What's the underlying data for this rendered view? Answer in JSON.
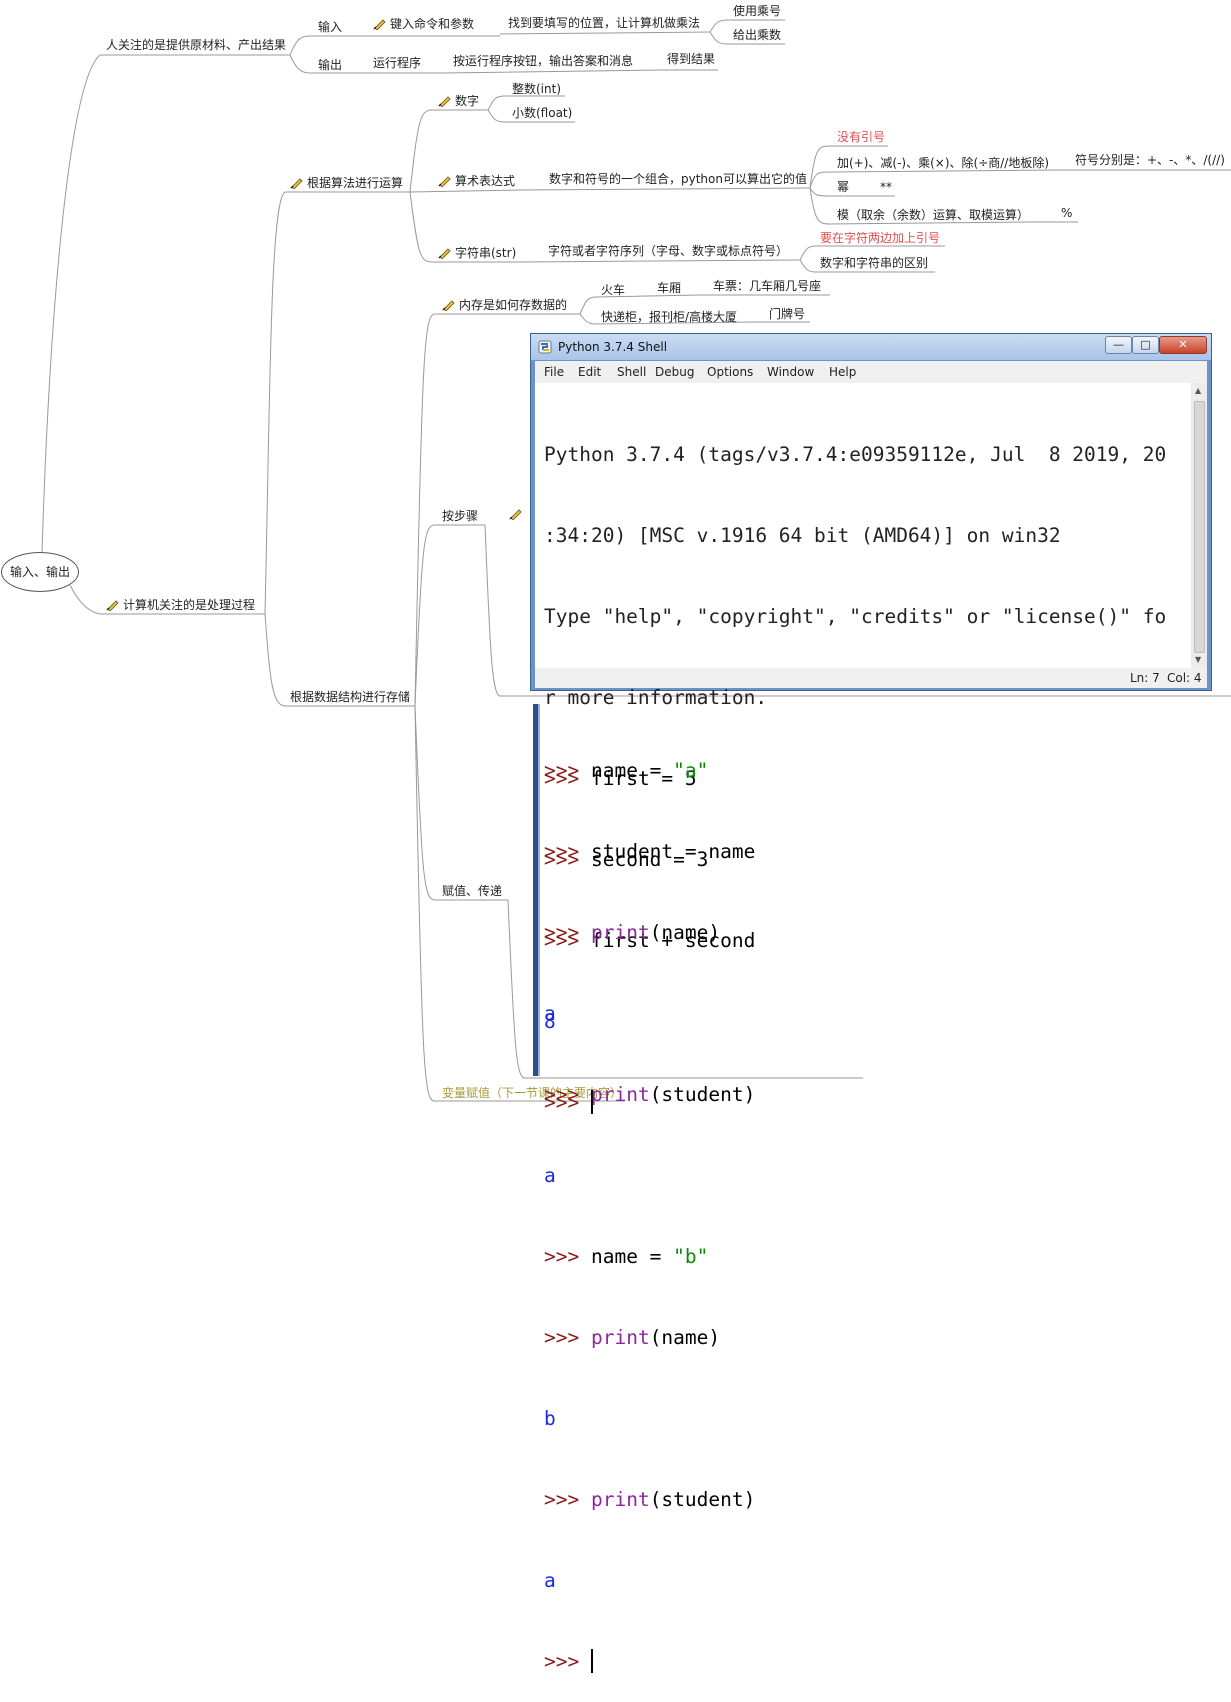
{
  "root": {
    "label": "输入、输出"
  },
  "human": {
    "label": "人关注的是提供原材料、产出结果",
    "input": {
      "label": "输入",
      "action": "键入命令和参数",
      "detail": "找到要填写的位置，让计算机做乘法",
      "children": [
        "使用乘号",
        "给出乘数"
      ]
    },
    "output": {
      "label": "输出",
      "action": "运行程序",
      "detail": "按运行程序按钮，输出答案和消息",
      "result": "得到结果"
    }
  },
  "computer": {
    "label": "计算机关注的是处理过程",
    "algo": {
      "label": "根据算法进行运算",
      "number": {
        "label": "数字",
        "children": [
          "整数(int)",
          "小数(float)"
        ]
      },
      "expr": {
        "label": "算术表达式",
        "detail": "数字和符号的一个组合，python可以算出它的值",
        "no_quote": "没有引号",
        "ops": "加(+)、减(-)、乘(×)、除(÷商//地板除)",
        "ops_symbols": "符号分别是：+、-、*、/(//)",
        "power": "幂",
        "power_sym": "**",
        "mod": "模（取余（余数）运算、取模运算）",
        "mod_sym": "%"
      },
      "str": {
        "label": "字符串(str)",
        "detail": "字符或者字符序列（字母、数字或标点符号）",
        "quote": "要在字符两边加上引号",
        "diff": "数字和字符串的区别"
      }
    },
    "data": {
      "label": "根据数据结构进行存储",
      "memory": {
        "label": "内存是如何存数据的",
        "train": "火车",
        "car": "车厢",
        "ticket": "车票：几车厢几号座",
        "locker": "快递柜，报刊柜/高楼大厦",
        "door": "门牌号"
      },
      "steps": {
        "label": "按步骤"
      },
      "assign": {
        "label": "赋值、传递"
      },
      "var": {
        "label": "变量赋值（下一节课的主要内容）"
      }
    }
  },
  "shell": {
    "title": "Python 3.7.4 Shell",
    "menu": [
      "File",
      "Edit",
      "Shell",
      "Debug",
      "Options",
      "Window",
      "Help"
    ],
    "buttons": [
      "—",
      "□",
      "✕"
    ],
    "banner": [
      "Python 3.7.4 (tags/v3.7.4:e09359112e, Jul  8 2019, 20",
      ":34:20) [MSC v.1916 64 bit (AMD64)] on win32",
      "Type \"help\", \"copyright\", \"credits\" or \"license()\" fo",
      "r more information."
    ],
    "prompt": ">>>",
    "lines": [
      "first = 5",
      "second = 3",
      "first + second"
    ],
    "result": "8",
    "status": {
      "ln": "Ln: 7",
      "col": "Col: 4"
    }
  },
  "shell2": {
    "prompt": ">>>",
    "l1_a": "name = ",
    "l1_b": "\"a\"",
    "l2": "student = name",
    "print_kw": "print",
    "l3": "(name)",
    "out1": "a",
    "l4": "(student)",
    "out2": "a",
    "l5_a": "name = ",
    "l5_b": "\"b\"",
    "l6": "(name)",
    "out3": "b",
    "l7": "(student)",
    "out4": "a"
  }
}
